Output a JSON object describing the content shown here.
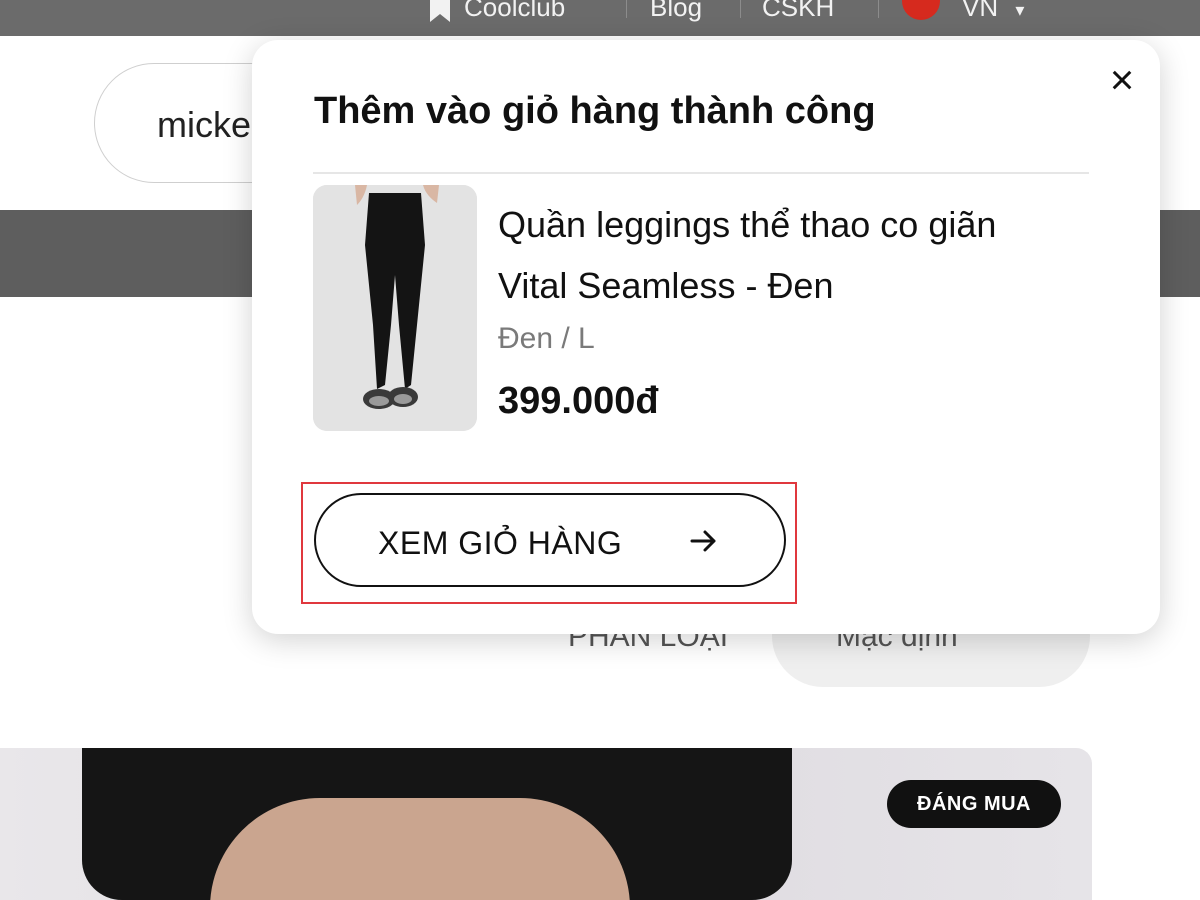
{
  "topbar": {
    "items": [
      "Coolclub",
      "Blog",
      "CSKH",
      "VN"
    ],
    "icon_coolclub": "bookmark-icon",
    "icon_language": "vietnam-flag-icon",
    "icon_dropdown": "chevron-down-icon"
  },
  "search": {
    "value": "micke"
  },
  "sort": {
    "label": "PHÂN LOẠI",
    "value": "Mặc định"
  },
  "product_card": {
    "badge": "ĐÁNG MUA"
  },
  "cart_popup": {
    "title": "Thêm vào giỏ hàng thành công",
    "product": {
      "name_line1": "Quần leggings thể thao co giãn",
      "name_line2": "Vital Seamless - Đen",
      "variant": "Đen / L",
      "price": "399.000đ"
    },
    "view_cart_label": "XEM GIỎ HÀNG",
    "icons": {
      "close": "close-icon",
      "arrow": "arrow-right-icon"
    }
  },
  "colors": {
    "topbar": "#6b6b6b",
    "highlight": "#e0383e",
    "badge_bg": "#111111"
  }
}
